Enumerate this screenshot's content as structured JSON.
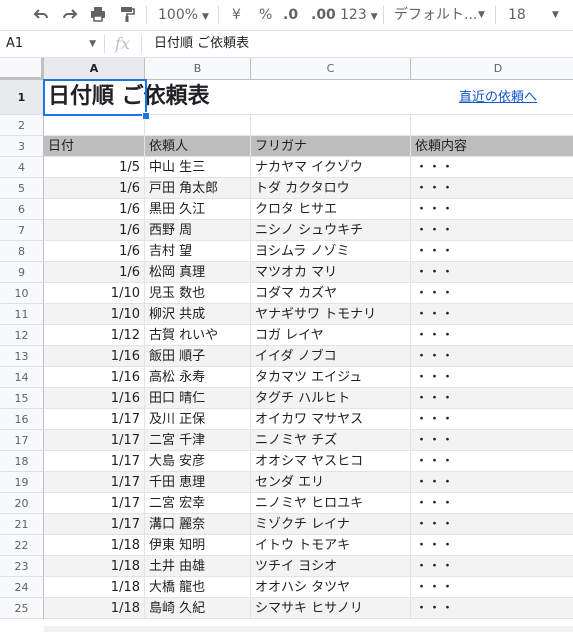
{
  "toolbar": {
    "zoom": "100%",
    "currency": "¥",
    "percent": "%",
    "decrease_decimal": ".0",
    "increase_decimal": ".00",
    "more_formats": "123",
    "font": "デフォルト...",
    "font_size": "18"
  },
  "formula_bar": {
    "cell_ref": "A1",
    "fx": "fx",
    "value": "日付順 ご依頼表"
  },
  "columns": [
    "A",
    "B",
    "C",
    "D"
  ],
  "title": "日付順 ご依頼表",
  "link": "直近の依頼へ",
  "headers": [
    "日付",
    "依頼人",
    "フリガナ",
    "依頼内容"
  ],
  "rows": [
    {
      "n": "4",
      "date": "1/5",
      "name": "中山 生三",
      "kana": "ナカヤマ イクゾウ",
      "content": "・・・"
    },
    {
      "n": "5",
      "date": "1/6",
      "name": "戸田 角太郎",
      "kana": "トダ カクタロウ",
      "content": "・・・"
    },
    {
      "n": "6",
      "date": "1/6",
      "name": "黒田 久江",
      "kana": "クロタ ヒサエ",
      "content": "・・・"
    },
    {
      "n": "7",
      "date": "1/6",
      "name": "西野 周",
      "kana": "ニシノ シュウキチ",
      "content": "・・・"
    },
    {
      "n": "8",
      "date": "1/6",
      "name": "吉村 望",
      "kana": "ヨシムラ ノゾミ",
      "content": "・・・"
    },
    {
      "n": "9",
      "date": "1/6",
      "name": "松岡 真理",
      "kana": "マツオカ マリ",
      "content": "・・・"
    },
    {
      "n": "10",
      "date": "1/10",
      "name": "児玉 数也",
      "kana": "コダマ カズヤ",
      "content": "・・・"
    },
    {
      "n": "11",
      "date": "1/10",
      "name": "柳沢 共成",
      "kana": "ヤナギサワ トモナリ",
      "content": "・・・"
    },
    {
      "n": "12",
      "date": "1/12",
      "name": "古賀 れいや",
      "kana": "コガ レイヤ",
      "content": "・・・"
    },
    {
      "n": "13",
      "date": "1/16",
      "name": "飯田 順子",
      "kana": "イイダ ノブコ",
      "content": "・・・"
    },
    {
      "n": "14",
      "date": "1/16",
      "name": "高松 永寿",
      "kana": "タカマツ エイジュ",
      "content": "・・・"
    },
    {
      "n": "15",
      "date": "1/16",
      "name": "田口 晴仁",
      "kana": "タグチ ハルヒト",
      "content": "・・・"
    },
    {
      "n": "16",
      "date": "1/17",
      "name": "及川 正保",
      "kana": "オイカワ マサヤス",
      "content": "・・・"
    },
    {
      "n": "17",
      "date": "1/17",
      "name": "二宮 千津",
      "kana": "ニノミヤ チズ",
      "content": "・・・"
    },
    {
      "n": "18",
      "date": "1/17",
      "name": "大島 安彦",
      "kana": "オオシマ ヤスヒコ",
      "content": "・・・"
    },
    {
      "n": "19",
      "date": "1/17",
      "name": "千田 恵理",
      "kana": "センダ エリ",
      "content": "・・・"
    },
    {
      "n": "20",
      "date": "1/17",
      "name": "二宮 宏幸",
      "kana": "ニノミヤ ヒロユキ",
      "content": "・・・"
    },
    {
      "n": "21",
      "date": "1/17",
      "name": "溝口 麗奈",
      "kana": "ミゾクチ レイナ",
      "content": "・・・"
    },
    {
      "n": "22",
      "date": "1/18",
      "name": "伊東 知明",
      "kana": "イトウ トモアキ",
      "content": "・・・"
    },
    {
      "n": "23",
      "date": "1/18",
      "name": "土井 由雄",
      "kana": "ツチイ ヨシオ",
      "content": "・・・"
    },
    {
      "n": "24",
      "date": "1/18",
      "name": "大橋 龍也",
      "kana": "オオハシ タツヤ",
      "content": "・・・"
    },
    {
      "n": "25",
      "date": "1/18",
      "name": "島崎 久紀",
      "kana": "シマサキ ヒサノリ",
      "content": "・・・"
    }
  ],
  "row_labels_top": [
    "1",
    "2",
    "3"
  ]
}
